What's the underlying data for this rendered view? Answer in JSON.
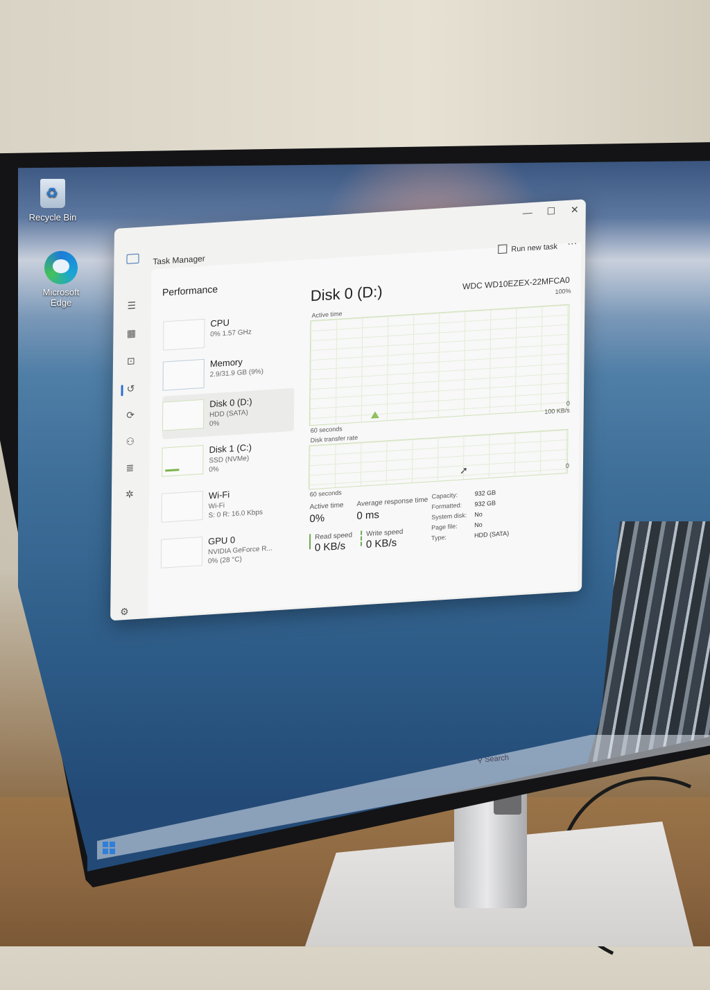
{
  "desktop": {
    "icons": [
      {
        "label": "Recycle Bin"
      },
      {
        "label": "Microsoft Edge"
      }
    ]
  },
  "window": {
    "app_title": "Task Manager",
    "controls": {
      "minimize": "—",
      "maximize": "☐",
      "close": "✕"
    }
  },
  "header": {
    "page_title": "Performance",
    "run_new_task": "Run new task",
    "more": "···"
  },
  "resources": [
    {
      "name": "CPU",
      "sub": "0% 1.57 GHz",
      "sub2": ""
    },
    {
      "name": "Memory",
      "sub": "2.9/31.9 GB (9%)",
      "sub2": ""
    },
    {
      "name": "Disk 0 (D:)",
      "sub": "HDD (SATA)",
      "sub2": "0%"
    },
    {
      "name": "Disk 1 (C:)",
      "sub": "SSD (NVMe)",
      "sub2": "0%"
    },
    {
      "name": "Wi-Fi",
      "sub": "Wi-Fi",
      "sub2": "S: 0 R: 16.0 Kbps"
    },
    {
      "name": "GPU 0",
      "sub": "NVIDIA GeForce R...",
      "sub2": "0% (28 °C)"
    }
  ],
  "selected_index": 2,
  "detail": {
    "title": "Disk 0 (D:)",
    "model": "WDC WD10EZEX-22MFCA0",
    "active_time_graph": {
      "label": "Active time",
      "max": "100%",
      "min": "0",
      "span": "60 seconds"
    },
    "transfer_graph": {
      "label": "Disk transfer rate",
      "max": "100 KB/s",
      "min": "0",
      "span": "60 seconds"
    },
    "stats": {
      "active_time_label": "Active time",
      "active_time_value": "0%",
      "avg_response_label": "Average response time",
      "avg_response_value": "0 ms",
      "read_label": "Read speed",
      "read_value": "0 KB/s",
      "write_label": "Write speed",
      "write_value": "0 KB/s"
    },
    "properties": [
      {
        "key": "Capacity:",
        "value": "932 GB"
      },
      {
        "key": "Formatted:",
        "value": "932 GB"
      },
      {
        "key": "System disk:",
        "value": "No"
      },
      {
        "key": "Page file:",
        "value": "No"
      },
      {
        "key": "Type:",
        "value": "HDD (SATA)"
      }
    ]
  },
  "taskbar": {
    "search_placeholder": "Search"
  },
  "colors": {
    "accent": "#2a6fd0",
    "disk_green": "#6aa84f",
    "window_bg": "#f2f2f1"
  },
  "icons": {
    "nav": [
      "hamburger-icon",
      "processes-icon",
      "performance-icon",
      "app-history-icon",
      "startup-icon",
      "users-icon",
      "details-icon",
      "services-icon"
    ],
    "settings": "gear-icon"
  }
}
